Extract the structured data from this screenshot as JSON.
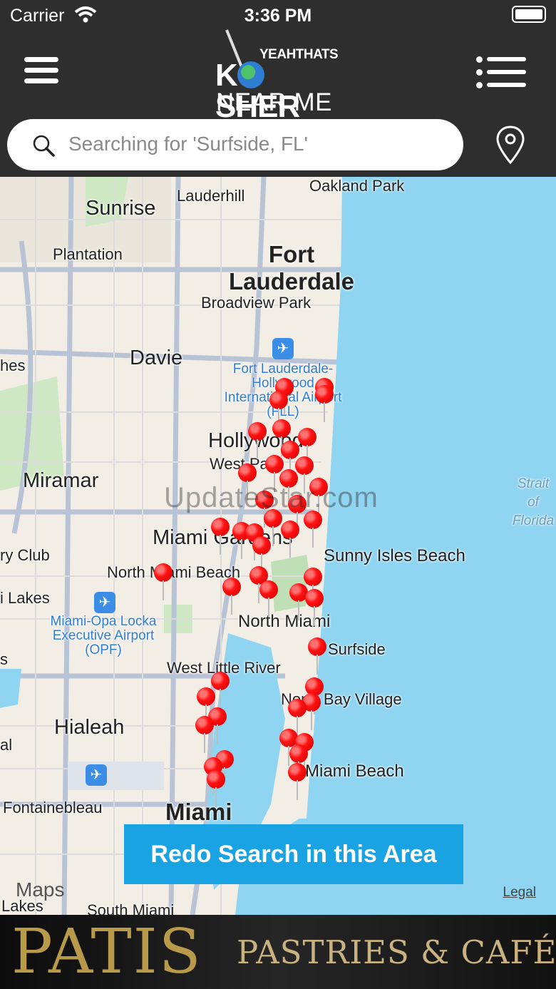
{
  "status_bar": {
    "carrier": "Carrier",
    "time": "3:36 PM"
  },
  "header": {
    "logo_top": "YEAHTHATS",
    "logo_main_k": "K",
    "logo_main_rest": "SHER",
    "logo_sub": "NEAR ME"
  },
  "search": {
    "text": "Searching for 'Surfside, FL'"
  },
  "map": {
    "labels": {
      "sunrise": "Sunrise",
      "lauderhill": "Lauderhill",
      "oakland_park": "Oakland Park",
      "plantation": "Plantation",
      "fort_lauderdale": "Fort Lauderdale",
      "broadview_park": "Broadview Park",
      "davie": "Davie",
      "hes": "hes",
      "fll_airport": "Fort Lauderdale-Hollywood International Airport (FLL)",
      "hollywood": "Hollywood",
      "west_park": "West Park",
      "miramar": "Miramar",
      "strait_of_florida": "Strait of Florida",
      "miami_gardens": "Miami Gardens",
      "sunny_isles": "Sunny Isles Beach",
      "country_club": "ry Club",
      "north_miami_beach": "North Miami Beach",
      "lakes": "i Lakes",
      "opa_locka": "Miami-Opa Locka Executive Airport (OPF)",
      "north_miami": "North Miami",
      "surfside": "Surfside",
      "s": "s",
      "west_little_river": "West Little River",
      "bay_village": "North Bay Village",
      "hialeah": "Hialeah",
      "al": "al",
      "miami_beach": "Miami Beach",
      "fontainebleau": "Fontainebleau",
      "miami": "Miami",
      "lakes_bottom": "Lakes",
      "south_miami": "South Miami"
    },
    "watermark": "UpdateStar.com",
    "maps_brand": "Maps",
    "legal": "Legal",
    "redo_button": "Redo Search in this Area"
  },
  "ad": {
    "brand": "PATIS",
    "tagline": "PASTRIES & CAFÉ"
  },
  "colors": {
    "accent": "#1aa3e2",
    "pin": "#ff1212",
    "header": "#2e2e2e",
    "water": "#8fd4f0"
  }
}
